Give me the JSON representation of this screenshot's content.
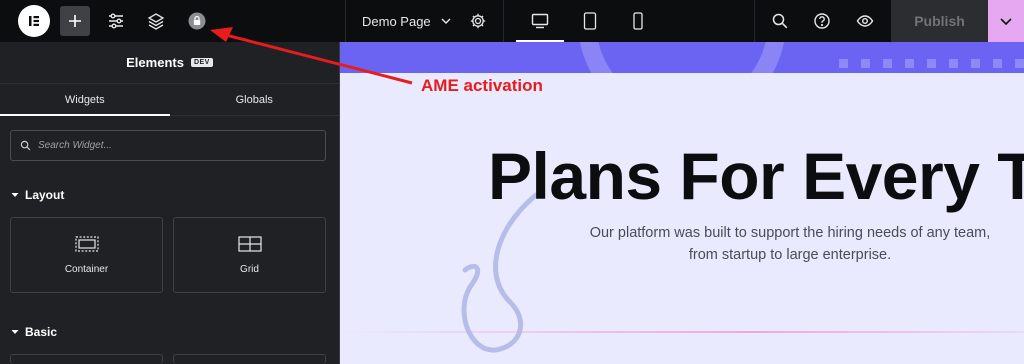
{
  "topbar": {
    "page_name": "Demo Page",
    "publish_label": "Publish",
    "icons": [
      "elementor-logo-icon",
      "plus-icon",
      "sliders-icon",
      "layers-icon",
      "lock-icon",
      "chevron-down-icon",
      "gear-icon",
      "desktop-icon",
      "tablet-icon",
      "mobile-icon",
      "search-icon",
      "help-icon",
      "eye-icon"
    ]
  },
  "sidebar": {
    "title": "Elements",
    "badge": "DEV",
    "tabs": [
      {
        "label": "Widgets",
        "active": true
      },
      {
        "label": "Globals",
        "active": false
      }
    ],
    "search_placeholder": "Search Widget...",
    "categories": [
      {
        "label": "Layout",
        "widgets": [
          {
            "label": "Container"
          },
          {
            "label": "Grid"
          }
        ]
      },
      {
        "label": "Basic"
      }
    ]
  },
  "canvas": {
    "title": "Plans For Every Tea",
    "subtitle": "Our platform was built to support the hiring needs of any team, from startup to large enterprise."
  },
  "annotation": {
    "text": "AME activation",
    "color": "#e81c1c"
  },
  "colors": {
    "topbar_bg": "#0c0d0e",
    "sidebar_bg": "#1f2124",
    "canvas_bg": "#e9eafd",
    "accent_band": "#6b64f2",
    "publish_menu": "#e6a8f0"
  }
}
